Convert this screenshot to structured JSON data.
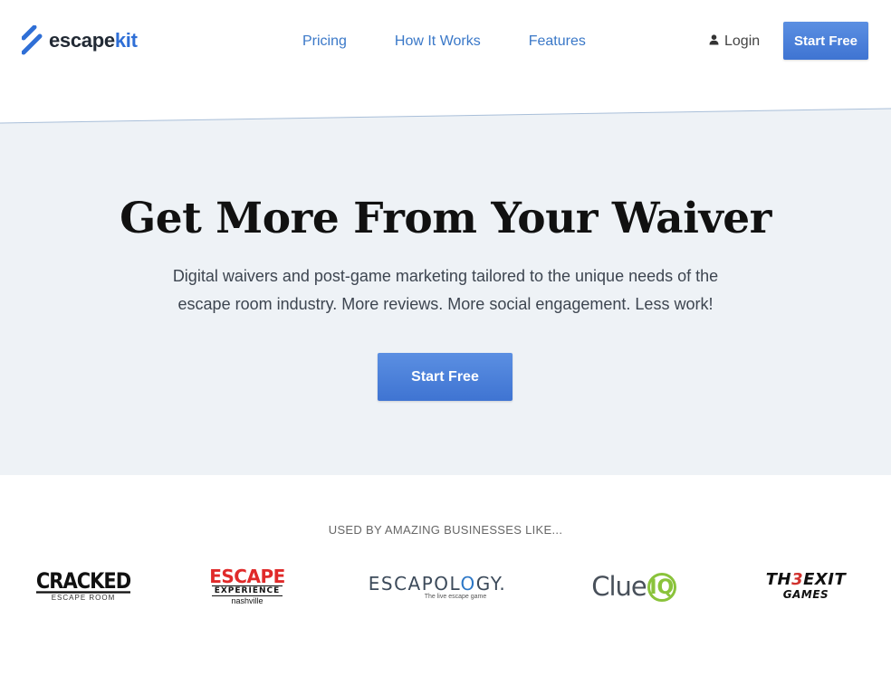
{
  "header": {
    "logo": {
      "text_main": "escape",
      "text_accent": "kit"
    },
    "nav": [
      {
        "label": "Pricing"
      },
      {
        "label": "How It Works"
      },
      {
        "label": "Features"
      }
    ],
    "login_label": "Login",
    "start_free_label": "Start Free"
  },
  "hero": {
    "title": "Get More From Your Waiver",
    "subtitle": "Digital waivers and post-game marketing tailored to the unique needs of the escape room industry. More reviews. More social engagement. Less work!",
    "cta_label": "Start Free"
  },
  "customers": {
    "heading": "USED BY AMAZING BUSINESSES LIKE...",
    "logos": [
      {
        "name": "Cracked Escape Room",
        "line1": "CRACKED",
        "line2": "ESCAPE ROOM"
      },
      {
        "name": "Escape Experience Nashville",
        "line1": "ESCAPE",
        "line2": "EXPERIENCE",
        "line3": "nashville"
      },
      {
        "name": "Escapology",
        "line1_a": "ESCAPOL",
        "line1_o": "O",
        "line1_b": "GY.",
        "line2": "The live escape game"
      },
      {
        "name": "ClueIQ",
        "line1": "Clue",
        "line1_accent": "IQ"
      },
      {
        "name": "The Exit Games",
        "line1_a": "TH",
        "line1_accent": "3",
        "line1_b": "EXIT",
        "line2": "GAMES"
      }
    ]
  },
  "colors": {
    "accent": "#3a78c8",
    "button": "#4a7fd9",
    "hero_bg": "#eef2f6"
  }
}
